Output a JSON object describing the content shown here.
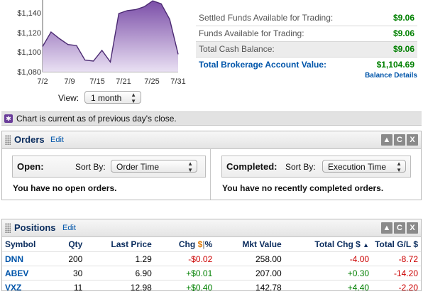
{
  "chart": {
    "y_ticks": [
      "$1,140",
      "$1,120",
      "$1,100",
      "$1,080"
    ],
    "x_ticks": [
      "7/2",
      "7/9",
      "7/15",
      "7/21",
      "7/25",
      "7/31"
    ],
    "view_label": "View:",
    "view_value": "1 month",
    "fill_color": "#7b4ea8",
    "series_values": [
      1106,
      1121,
      1114,
      1108,
      1107,
      1092,
      1091,
      1102,
      1090,
      1140,
      1143,
      1144,
      1147,
      1153,
      1150,
      1134,
      1098
    ]
  },
  "funds": {
    "rows": [
      {
        "label": "Settled Funds Available for Trading:",
        "value": "$9.06"
      },
      {
        "label": "Funds Available for Trading:",
        "value": "$9.06"
      },
      {
        "label": "Total Cash Balance:",
        "value": "$9.06"
      },
      {
        "label": "Total Brokerage Account Value:",
        "value": "$1,104.69"
      }
    ],
    "balance_details": "Balance Details"
  },
  "notice": {
    "text": "Chart is current as of previous day's close."
  },
  "orders": {
    "title": "Orders",
    "edit": "Edit",
    "buttons": [
      "▲",
      "C",
      "X"
    ],
    "open": {
      "title": "Open:",
      "sort_label": "Sort By:",
      "sort_value": "Order Time",
      "message": "You have no open orders."
    },
    "completed": {
      "title": "Completed:",
      "sort_label": "Sort By:",
      "sort_value": "Execution Time",
      "message": "You have no recently completed orders."
    }
  },
  "positions": {
    "title": "Positions",
    "edit": "Edit",
    "buttons": [
      "▲",
      "C",
      "X"
    ],
    "headers": {
      "symbol": "Symbol",
      "qty": "Qty",
      "last_price": "Last Price",
      "chg_prefix": "Chg",
      "chg_dollar": "$",
      "chg_sep": "|",
      "chg_pct": "%",
      "mkt_value": "Mkt Value",
      "total_chg": "Total Chg $",
      "sort_arrow": "▲",
      "total_gl": "Total G/L $"
    },
    "rows": [
      {
        "symbol": "DNN",
        "qty": "200",
        "last_price": "1.29",
        "chg": "-$0.02",
        "mkt_value": "258.00",
        "total_chg": "-4.00",
        "total_gl": "-8.72"
      },
      {
        "symbol": "ABEV",
        "qty": "30",
        "last_price": "6.90",
        "chg": "+$0.01",
        "mkt_value": "207.00",
        "total_chg": "+0.30",
        "total_gl": "-14.20"
      },
      {
        "symbol": "VXZ",
        "qty": "11",
        "last_price": "12.98",
        "chg": "+$0.40",
        "mkt_value": "142.78",
        "total_chg": "+4.40",
        "total_gl": "-2.20"
      }
    ]
  }
}
